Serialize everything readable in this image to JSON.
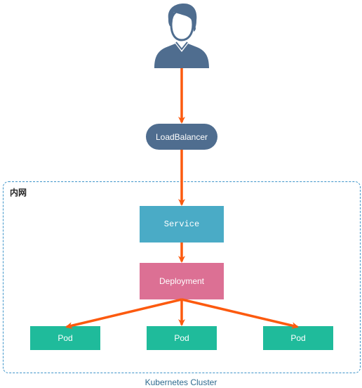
{
  "diagram": {
    "user": {
      "icon": "user-icon",
      "color": "#4f6d8f"
    },
    "load_balancer": {
      "label": "LoadBalancer",
      "color": "#4f6d8f"
    },
    "cluster": {
      "name": "Kubernetes Cluster",
      "network_label": "内网",
      "border_color": "#3d94c9"
    },
    "service": {
      "label": "Service",
      "color": "#4aabc6"
    },
    "deployment": {
      "label": "Deployment",
      "color": "#dc7094"
    },
    "pods": [
      {
        "label": "Pod"
      },
      {
        "label": "Pod"
      },
      {
        "label": "Pod"
      }
    ],
    "pod_color": "#1fbb9b",
    "arrow_color": "#fc5a0f",
    "edges": [
      {
        "from": "user",
        "to": "load_balancer"
      },
      {
        "from": "load_balancer",
        "to": "service"
      },
      {
        "from": "service",
        "to": "deployment"
      },
      {
        "from": "deployment",
        "to": "pod-1"
      },
      {
        "from": "deployment",
        "to": "pod-2"
      },
      {
        "from": "deployment",
        "to": "pod-3"
      }
    ]
  }
}
